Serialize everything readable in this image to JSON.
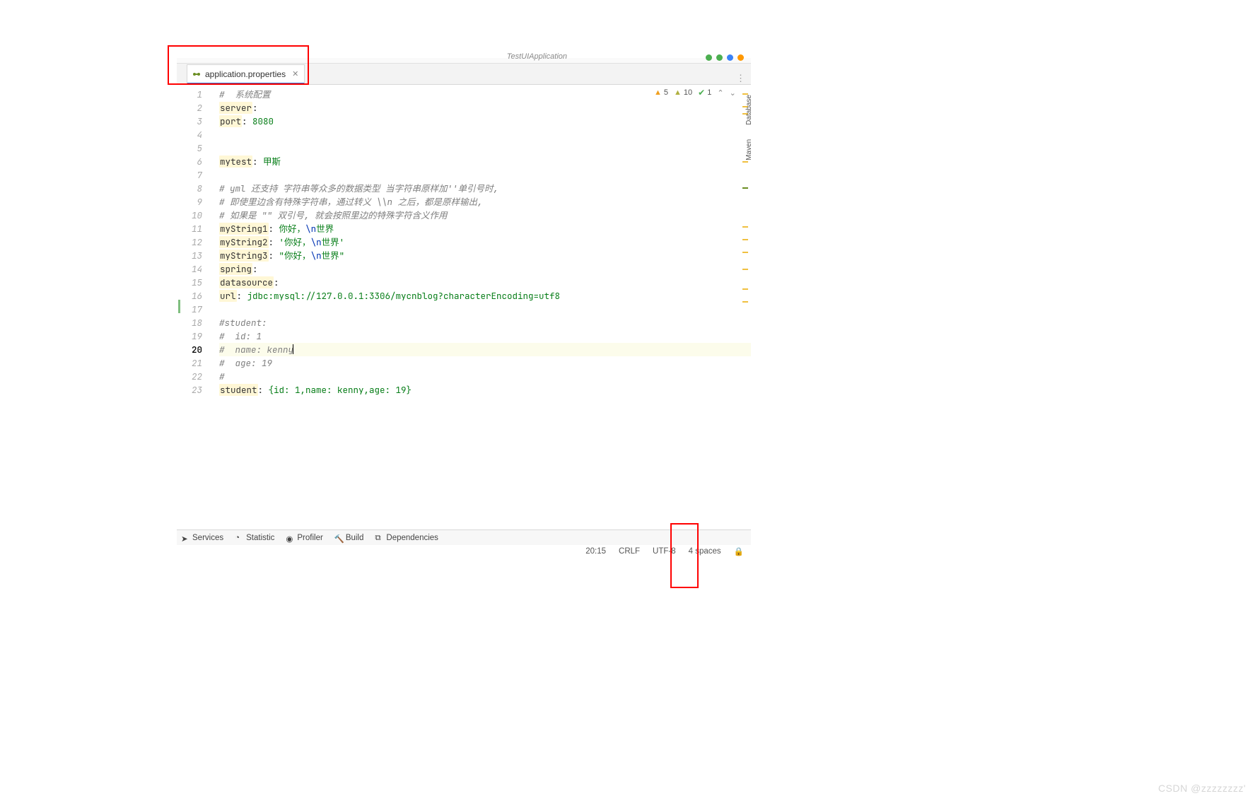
{
  "tab": {
    "filename": "application.properties"
  },
  "toolbar_hint": {
    "run_config": "TestUIApplication"
  },
  "inspections": {
    "warning_count": "5",
    "weak_warning_count": "10",
    "typo_count": "1"
  },
  "code_lines": [
    {
      "n": 1,
      "type": "comment",
      "text": "#  系统配置"
    },
    {
      "n": 2,
      "type": "kv",
      "key": "server",
      "val": ""
    },
    {
      "n": 3,
      "type": "kv",
      "key": "port",
      "val": "8080"
    },
    {
      "n": 4,
      "type": "blank"
    },
    {
      "n": 5,
      "type": "blank"
    },
    {
      "n": 6,
      "type": "kv",
      "key": "mytest",
      "val": "甲斯"
    },
    {
      "n": 7,
      "type": "blank"
    },
    {
      "n": 8,
      "type": "comment",
      "text": "# yml 还支持 字符串等众多的数据类型 当字符串原样加''单引号时,"
    },
    {
      "n": 9,
      "type": "comment",
      "text": "# 即使里边含有特殊字符串，通过转义 \\\\n 之后，都是原样输出,"
    },
    {
      "n": 10,
      "type": "comment",
      "text": "# 如果是 \"\" 双引号, 就会按照里边的特殊字符含义作用"
    },
    {
      "n": 11,
      "type": "kv_esc",
      "key": "myString1",
      "pre": "你好，",
      "esc": "\\n",
      "post": "世界"
    },
    {
      "n": 12,
      "type": "kv_sq",
      "key": "myString2",
      "pre": "'你好，",
      "esc": "\\n",
      "post": "世界'"
    },
    {
      "n": 13,
      "type": "kv_dq",
      "key": "myString3",
      "pre": "\"你好，",
      "esc": "\\n",
      "post": "世界\""
    },
    {
      "n": 14,
      "type": "kv",
      "key": "spring",
      "val": ""
    },
    {
      "n": 15,
      "type": "kv",
      "key": "datasource",
      "val": ""
    },
    {
      "n": 16,
      "type": "kv",
      "key": "url",
      "val": "jdbc:mysql://127.0.0.1:3306/mycnblog?characterEncoding=utf8"
    },
    {
      "n": 17,
      "type": "blank"
    },
    {
      "n": 18,
      "type": "comment",
      "text": "#student:"
    },
    {
      "n": 19,
      "type": "comment",
      "text": "#  id: 1"
    },
    {
      "n": 20,
      "type": "comment_caret",
      "text": "#  name: kenny"
    },
    {
      "n": 21,
      "type": "comment",
      "text": "#  age: 19"
    },
    {
      "n": 22,
      "type": "comment",
      "text": "#"
    },
    {
      "n": 23,
      "type": "kv_inline",
      "key": "student",
      "val": "{id: 1,name: kenny,age: 19}"
    }
  ],
  "bottom_tools": {
    "services": "Services",
    "statistic": "Statistic",
    "profiler": "Profiler",
    "build": "Build",
    "dependencies": "Dependencies"
  },
  "status": {
    "caret": "20:15",
    "line_sep": "CRLF",
    "encoding": "UTF-8",
    "indent": "4 spaces"
  },
  "watermark": "CSDN @zzzzzzzz'"
}
